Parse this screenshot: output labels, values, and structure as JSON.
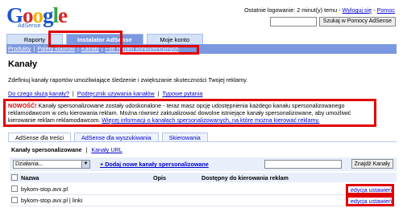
{
  "logo": {
    "letters": [
      "G",
      "o",
      "o",
      "g",
      "l",
      "e"
    ],
    "sub": "AdSense"
  },
  "header": {
    "last_login": "Ostatnie logowanie: 2 minut(y) temu -",
    "logout": "Wyloguj się",
    "sep": "-",
    "help": "Pomoc",
    "search_button": "Szukaj w Pomocy AdSense"
  },
  "tabs": [
    {
      "label": "Raporty"
    },
    {
      "label": "Instalator AdSense",
      "active": true
    },
    {
      "label": "Moje konto"
    }
  ],
  "subnav": [
    "Produkty",
    "Palety kolorów",
    "Kanały",
    "Filtr reklam konkurencyjnych"
  ],
  "subnav_sep": "|",
  "page": {
    "title": "Kanały",
    "description": "Zdefiniuj kanały raportów umożliwiające śledzenie i zwiększanie skuteczności Twojej reklamy.",
    "help_links": [
      "Do czego służą kanały?",
      "Podręcznik używania kanałów",
      "Typowe pytania"
    ],
    "help_sep": "|"
  },
  "notice": {
    "label": "NOWOŚĆ!",
    "text": " Kanały spersonalizowane zostały udoskonalone - teraz masz opcję udostępnienia każdego kanału spersonalizowanego reklamodawcom w celu kierowania reklam. Można również zaktualizować dowolne istniejące kanały spersonalizowane, aby umożliwić kierowanie reklam reklamodawcom. ",
    "link": "Więcej informacji o kanałach spersonalizowanych, na które można kierować reklamy."
  },
  "product_tabs": [
    {
      "label": "AdSense dla treści",
      "active": true
    },
    {
      "label": "AdSense dla wyszukiwania"
    },
    {
      "label": "Skierowania"
    }
  ],
  "channel_types": {
    "current": "Kanały spersonalizowane",
    "sep": "|",
    "other": "Kanały URL"
  },
  "toolbar": {
    "actions_value": "Działania...",
    "arrow": "▼",
    "add_link": "+ Dodaj nowe kanały spersonalizowane",
    "find_button": "Znajdź Kanały"
  },
  "table": {
    "headers": {
      "name": "Nazwa",
      "opis": "Opis",
      "dost": "Dostępny do kierowania reklam"
    },
    "rows": [
      {
        "name": "bykom-stop.avx.pl",
        "opis": "",
        "dost": "",
        "edit": "edycja ustawień"
      },
      {
        "name": "bykom-stop.avx.pl | linki",
        "opis": "",
        "dost": "",
        "edit": "edycja ustawień"
      }
    ]
  },
  "colors": {
    "accent": "#7b98e0",
    "highlight": "#e00000",
    "link": "#0000cc"
  }
}
